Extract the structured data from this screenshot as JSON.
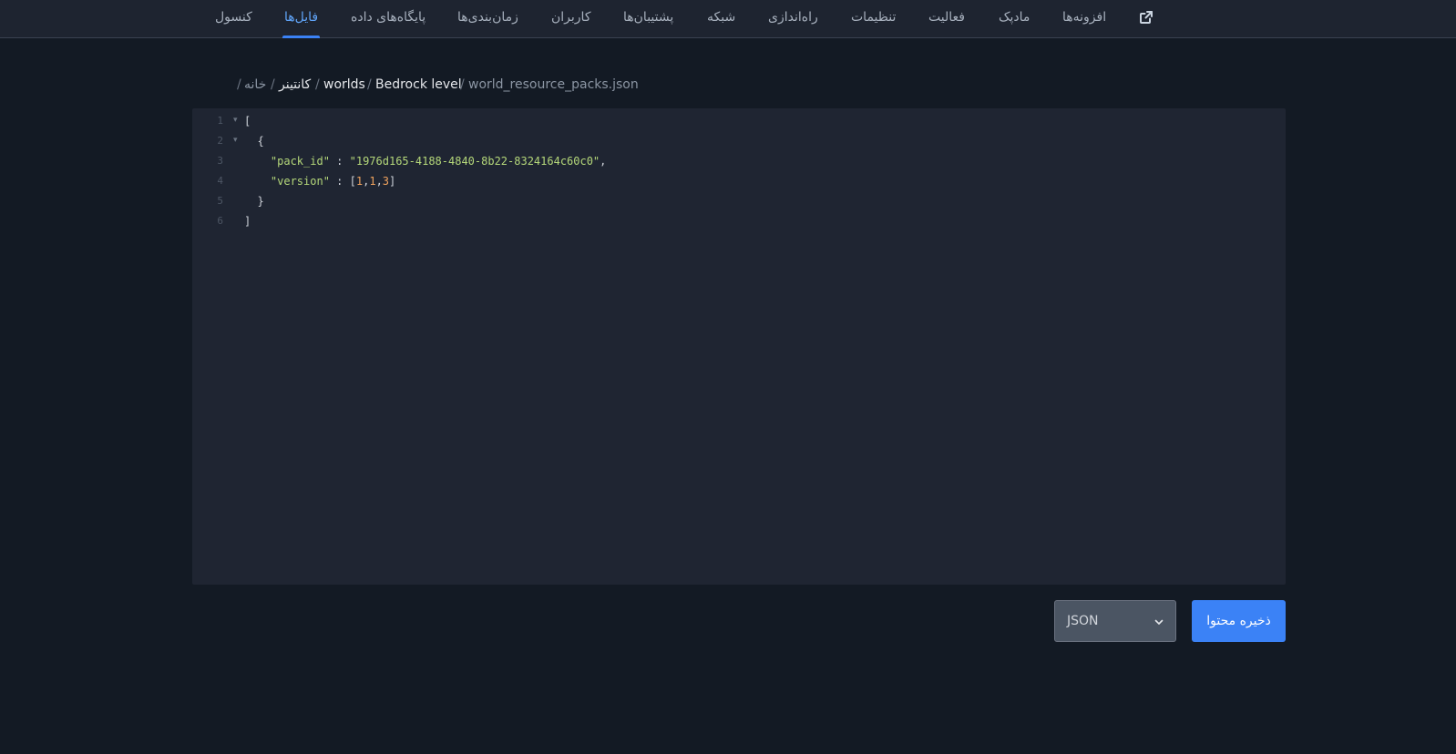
{
  "nav": {
    "items": [
      {
        "label": "کنسول"
      },
      {
        "label": "فایل‌ها",
        "active": true
      },
      {
        "label": "پایگاه‌های داده"
      },
      {
        "label": "زمان‌بندی‌ها"
      },
      {
        "label": "کاربران"
      },
      {
        "label": "پشتیبان‌ها"
      },
      {
        "label": "شبکه"
      },
      {
        "label": "راه‌اندازی"
      },
      {
        "label": "تنظیمات"
      },
      {
        "label": "فعالیت"
      },
      {
        "label": "مادپک"
      },
      {
        "label": "افزونه‌ها"
      }
    ],
    "external_icon": "external-link-icon",
    "accent": "#3b82f6"
  },
  "breadcrumb": {
    "items": [
      "خانه",
      "کانتینر",
      "worlds",
      "Bedrock level",
      "world_resource_packs.json"
    ],
    "separator": "/"
  },
  "editor": {
    "line_numbers": [
      "1",
      "2",
      "3",
      "4",
      "5",
      "6"
    ],
    "lines": [
      "[",
      "  {",
      "    \"pack_id\" : \"1976d165-4188-4840-8b22-8324164c60c0\",",
      "    \"version\" : [1,1,3]",
      "  }",
      "]"
    ],
    "tokens": {
      "open_bracket": "[",
      "open_brace": "{",
      "key_pack_id": "\"pack_id\"",
      "colon": " : ",
      "val_pack_id": "\"1976d165-4188-4840-8b22-8324164c60c0\"",
      "comma": ",",
      "key_version": "\"version\"",
      "arr_open": "[",
      "v1": "1",
      "v2": "1",
      "v3": "3",
      "arr_close": "]",
      "close_brace": "}",
      "close_bracket": "]"
    }
  },
  "footer": {
    "mode_value": "JSON",
    "save_label": "ذخیره محتوا"
  }
}
